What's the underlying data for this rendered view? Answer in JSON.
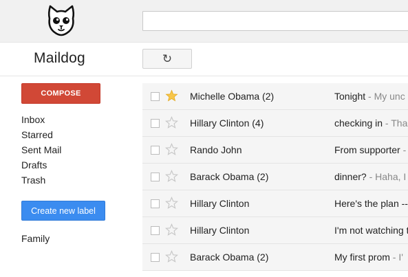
{
  "app": {
    "name": "Maildog"
  },
  "toolbar": {
    "refresh_icon": "refresh-icon",
    "refresh_glyph": "↻",
    "search_placeholder": ""
  },
  "sidebar": {
    "compose_label": "COMPOSE",
    "items": [
      {
        "label": "Inbox"
      },
      {
        "label": "Starred"
      },
      {
        "label": "Sent Mail"
      },
      {
        "label": "Drafts"
      },
      {
        "label": "Trash"
      }
    ],
    "new_label_button": "Create new label",
    "labels": [
      {
        "label": "Family"
      }
    ]
  },
  "colors": {
    "compose": "#d14836",
    "new_label": "#3b8cf0",
    "star_on": "#f7c64a",
    "star_off": "#c6c6c6"
  },
  "messages": [
    {
      "sender": "Michelle Obama (2)",
      "subject": "Tonight",
      "preview": " - My unc",
      "starred": true
    },
    {
      "sender": "Hillary Clinton (4)",
      "subject": "checking in",
      "preview": " - Tha",
      "starred": false
    },
    {
      "sender": "Rando John",
      "subject": "From supporter",
      "preview": " - ",
      "starred": false
    },
    {
      "sender": "Barack Obama (2)",
      "subject": "dinner?",
      "preview": " - Haha, I",
      "starred": false
    },
    {
      "sender": "Hillary Clinton",
      "subject": "Here's the plan --",
      "preview": "",
      "starred": false
    },
    {
      "sender": "Hillary Clinton",
      "subject": "I'm not watching t",
      "preview": "",
      "starred": false
    },
    {
      "sender": "Barack Obama (2)",
      "subject": "My first prom",
      "preview": " - I'",
      "starred": false
    }
  ]
}
